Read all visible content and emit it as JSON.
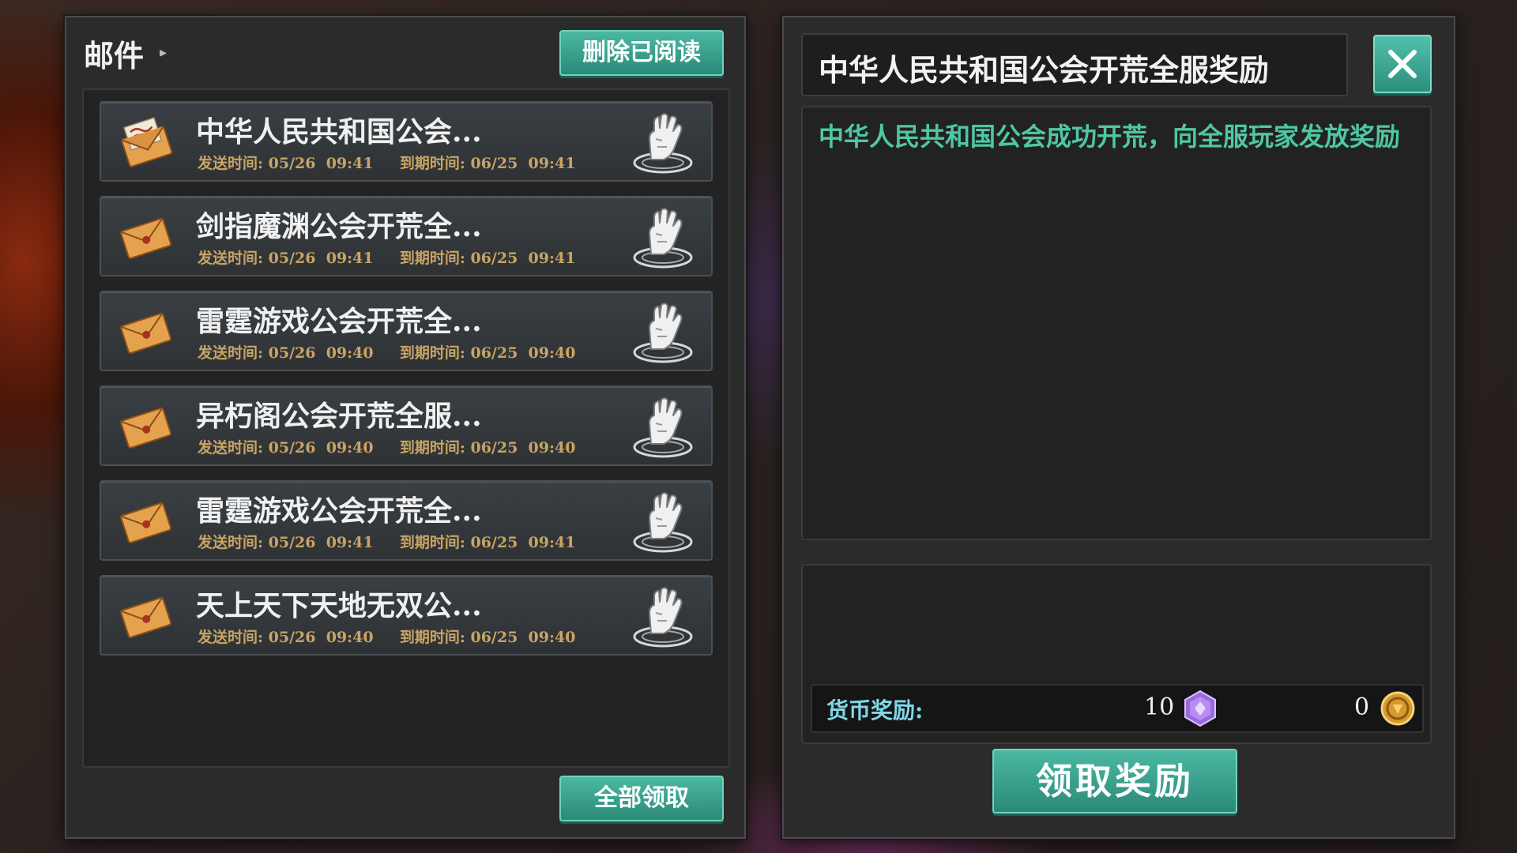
{
  "mail_panel": {
    "title": "邮件",
    "delete_read_label": "删除已阅读",
    "claim_all_label": "全部领取",
    "send_label": "发送时间:",
    "expire_label": "到期时间:",
    "items": [
      {
        "subject": "中华人民共和国公会...",
        "send_time": "05/26  09:41",
        "expire_time": "06/25  09:41",
        "opened": true
      },
      {
        "subject": "剑指魔渊公会开荒全...",
        "send_time": "05/26  09:41",
        "expire_time": "06/25  09:41",
        "opened": false
      },
      {
        "subject": "雷霆游戏公会开荒全...",
        "send_time": "05/26  09:40",
        "expire_time": "06/25  09:40",
        "opened": false
      },
      {
        "subject": "异朽阁公会开荒全服...",
        "send_time": "05/26  09:40",
        "expire_time": "06/25  09:40",
        "opened": false
      },
      {
        "subject": "雷霆游戏公会开荒全...",
        "send_time": "05/26  09:41",
        "expire_time": "06/25  09:41",
        "opened": false
      },
      {
        "subject": "天上天下天地无双公...",
        "send_time": "05/26  09:40",
        "expire_time": "06/25  09:40",
        "opened": false
      }
    ]
  },
  "detail_panel": {
    "title": "中华人民共和国公会开荒全服奖励",
    "body": "中华人民共和国公会成功开荒，向全服玩家发放奖励",
    "currency_label": "货币奖励:",
    "gem_value": "10",
    "gold_value": "0",
    "claim_label": "领取奖励"
  },
  "colors": {
    "accent_teal": "#3aa08c",
    "body_text_green": "#4fc7a3",
    "time_text": "#c9a464",
    "envelope": "#e0a050"
  },
  "icons": {
    "close": "close-icon",
    "envelope_open": "open-envelope-icon",
    "envelope": "envelope-icon",
    "claim": "gauntlet-hand-icon",
    "gem": "purple-gem-icon",
    "gold": "gold-coin-icon"
  }
}
